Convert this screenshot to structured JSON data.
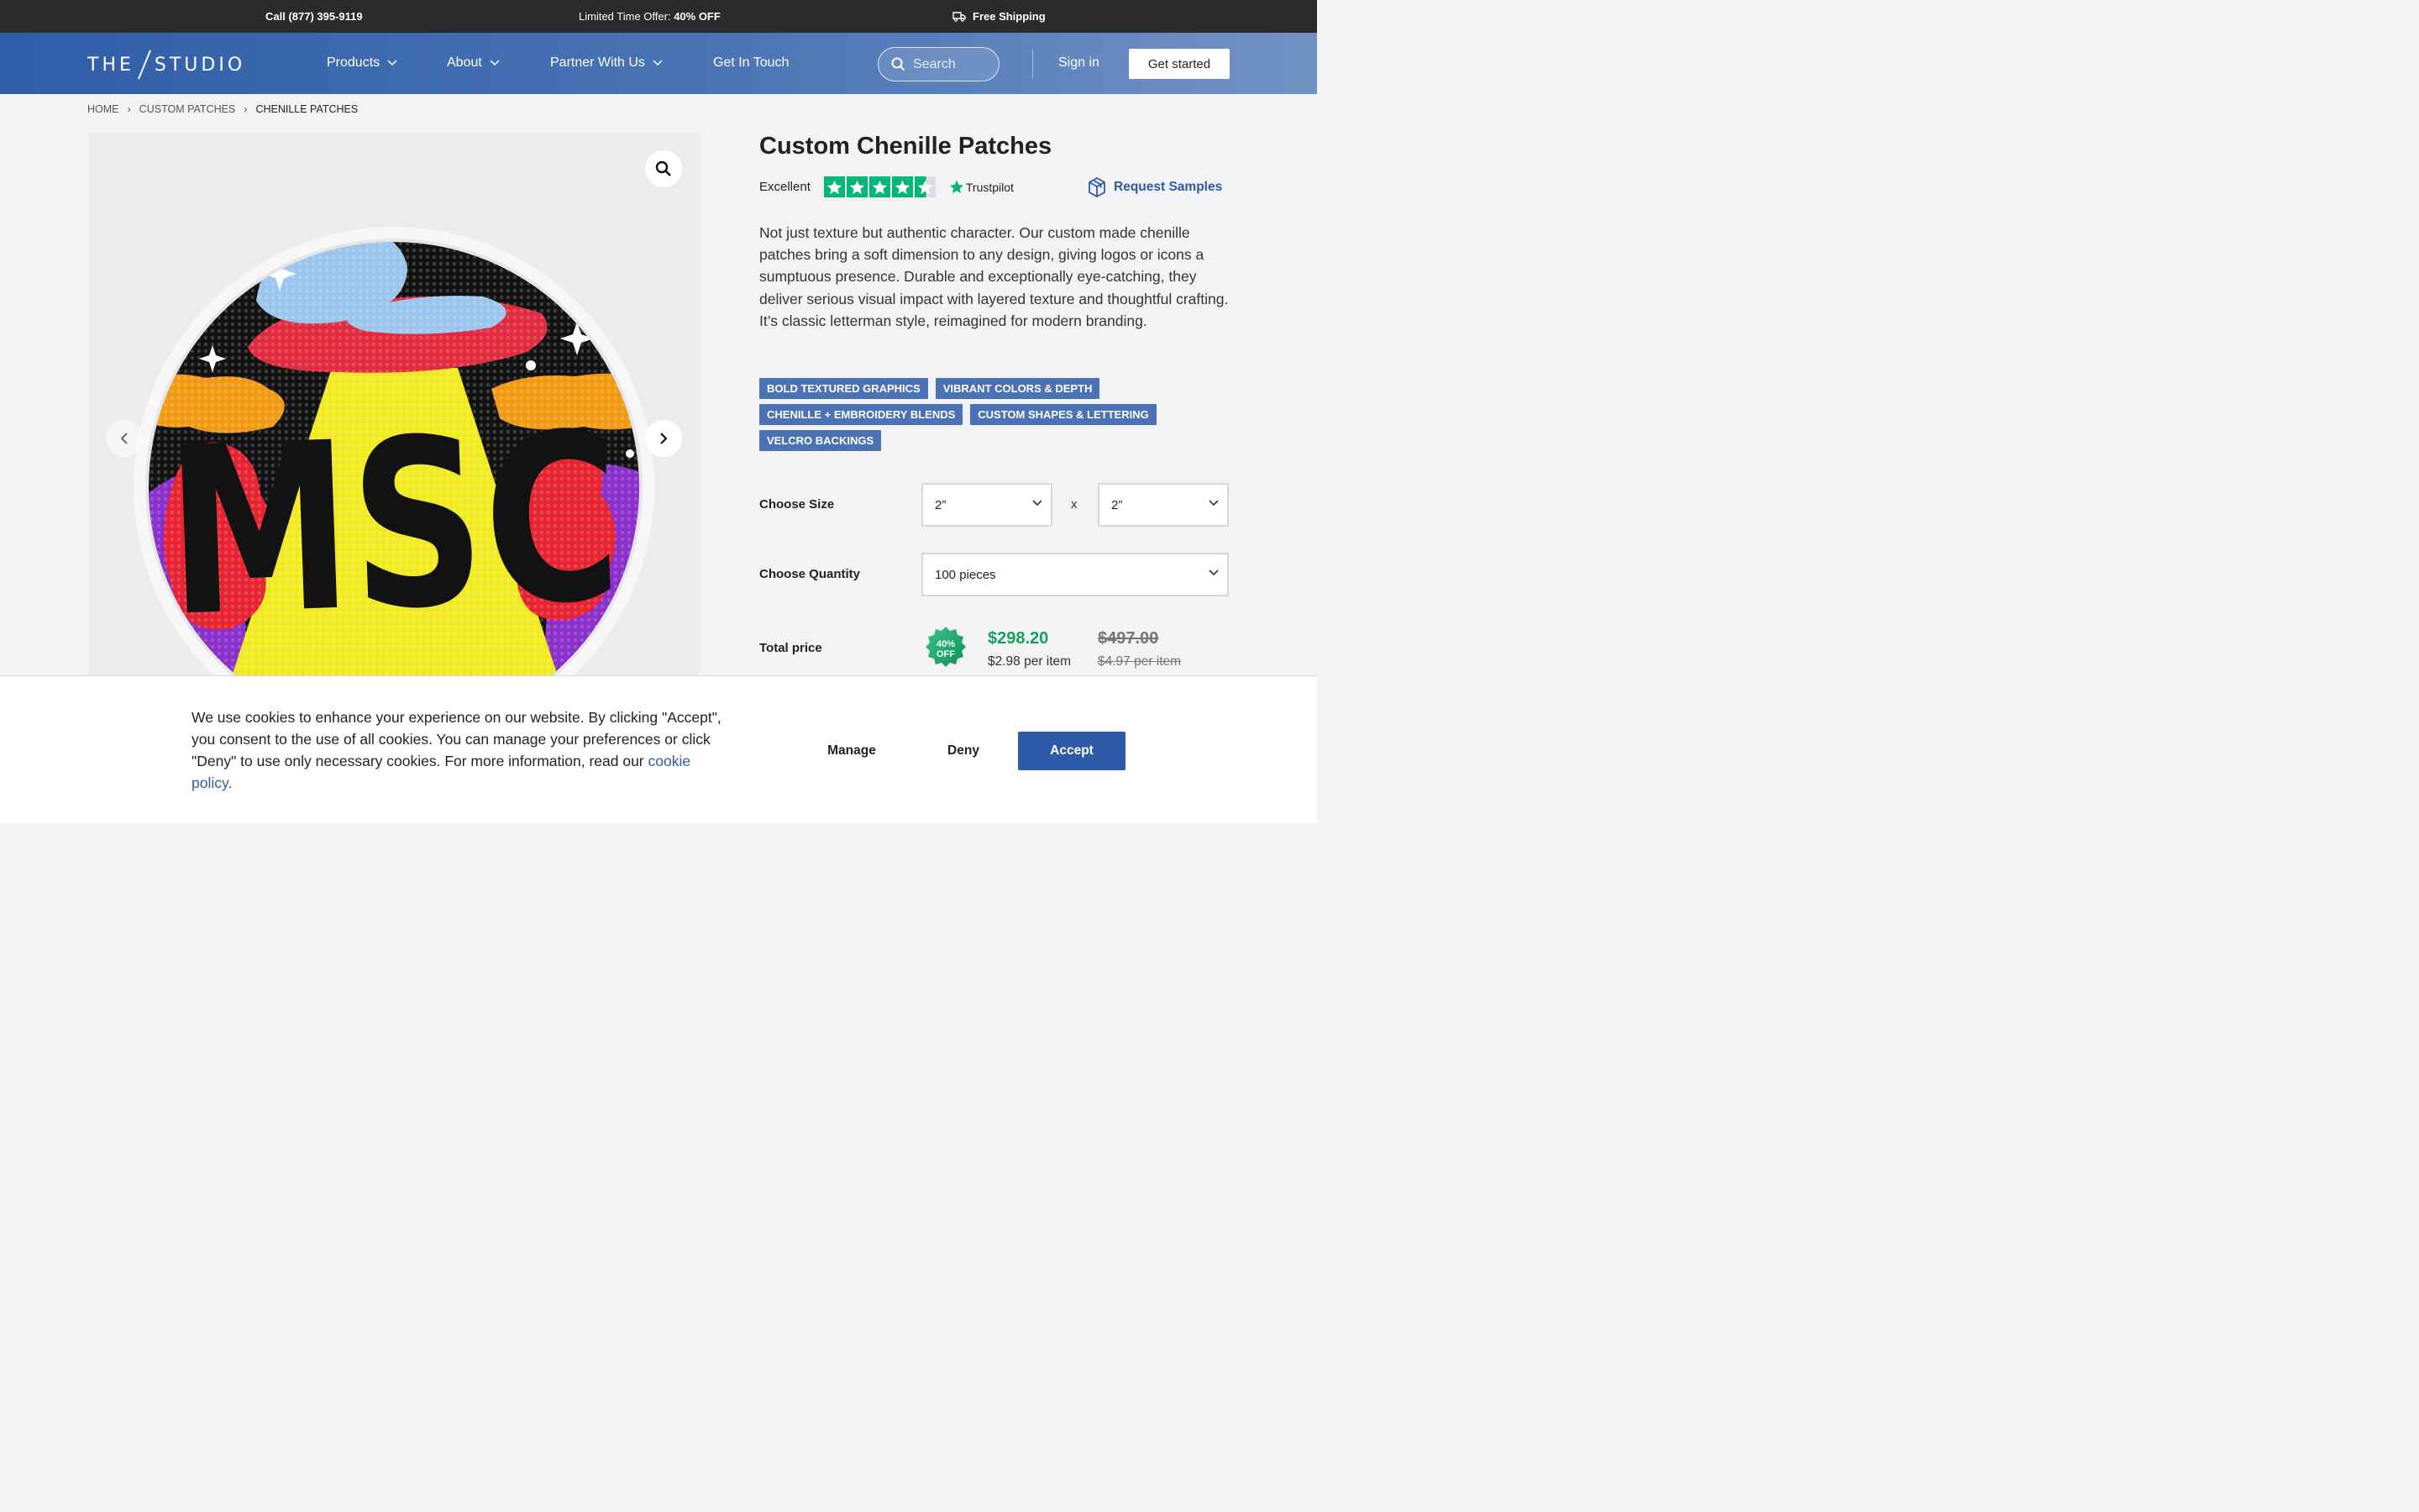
{
  "topbar": {
    "call": "Call (877) 395-9119",
    "offer_prefix": "Limited Time Offer: ",
    "offer_highlight": "40% OFF",
    "shipping": "Free Shipping"
  },
  "header": {
    "logo_left": "THE",
    "logo_right": "STUDIO",
    "nav": [
      {
        "label": "Products"
      },
      {
        "label": "About"
      },
      {
        "label": "Partner With Us"
      },
      {
        "label": "Get In Touch"
      }
    ],
    "search_placeholder": "Search",
    "sign_in": "Sign in",
    "get_started": "Get started"
  },
  "breadcrumb": [
    "HOME",
    "CUSTOM PATCHES",
    "CHENILLE PATCHES"
  ],
  "product": {
    "title": "Custom Chenille Patches",
    "rating_label": "Excellent",
    "rating_stars": 4.5,
    "trustpilot": "Trustpilot",
    "request_samples": "Request Samples",
    "description": "Not just texture but authentic character. Our custom made chenille patches bring a soft dimension to any design, giving logos or icons a sumptuous presence. Durable and exceptionally eye-catching, they deliver serious visual impact with layered texture and thoughtful crafting. It’s classic letterman style, reimagined for modern branding.",
    "tags": [
      "BOLD TEXTURED GRAPHICS",
      "VIBRANT COLORS & DEPTH",
      "CHENILLE + EMBROIDERY BLENDS",
      "CUSTOM SHAPES & LETTERING",
      "VELCRO BACKINGS"
    ],
    "patch_text": "MSC"
  },
  "options": {
    "size_label": "Choose Size",
    "width": "2”",
    "height": "2”",
    "times": "x",
    "quantity_label": "Choose Quantity",
    "quantity": "100 pieces",
    "total_label": "Total price",
    "badge_line1": "40%",
    "badge_line2": "OFF",
    "price": "$298.20",
    "per_item": "$2.98 per item",
    "old_price": "$497.00",
    "old_per_item": "$4.97 per item"
  },
  "cookie": {
    "text": "We use cookies to enhance your experience on our website. By clicking \"Accept\", you consent to the use of all cookies. You can manage your preferences or click \"Deny\" to use only necessary cookies. For more information, read our ",
    "link": "cookie policy.",
    "manage": "Manage",
    "deny": "Deny",
    "accept": "Accept"
  },
  "colors": {
    "brand_blue": "#2d5aa8",
    "tag_blue": "#4a72b4",
    "price_green": "#17a05d",
    "trustpilot_green": "#00b67a"
  }
}
